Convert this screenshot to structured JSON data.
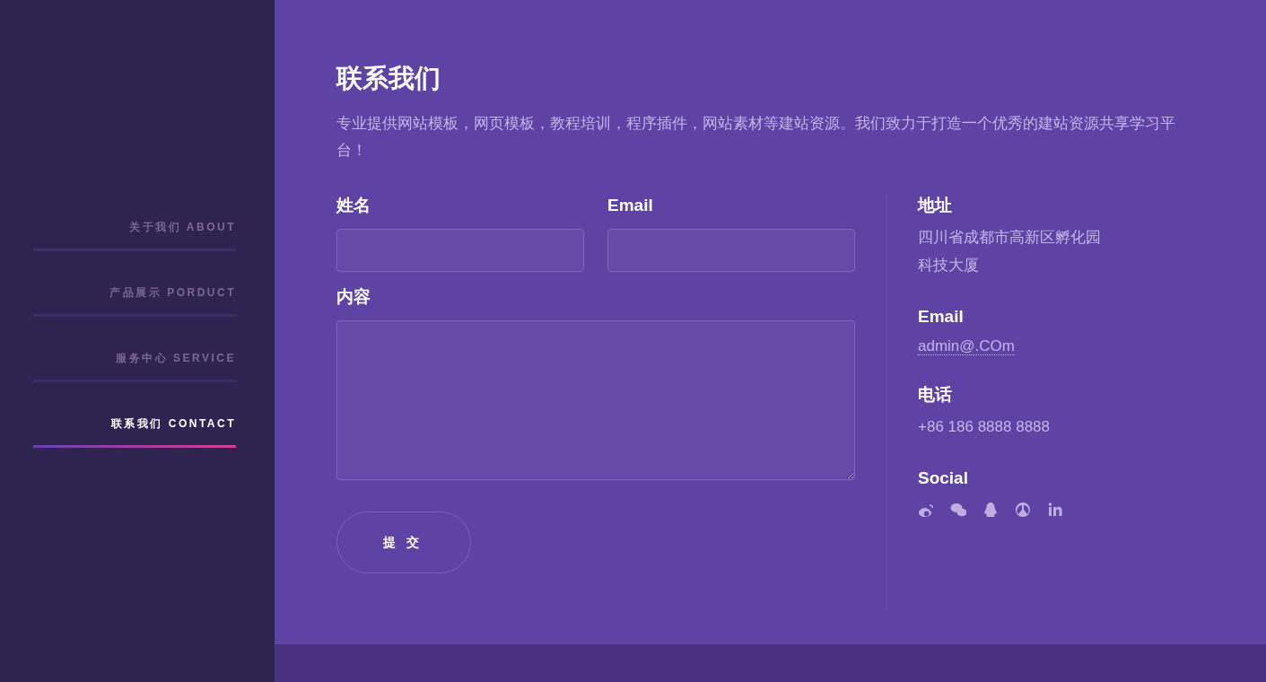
{
  "sidebar": {
    "items": [
      {
        "label": "关于我们 ABOUT",
        "selected": false
      },
      {
        "label": "产品展示 PORDUCT",
        "selected": false
      },
      {
        "label": "服务中心 SERVICE",
        "selected": false
      },
      {
        "label": "联系我们 CONTACT",
        "selected": true
      }
    ]
  },
  "contact": {
    "title": "联系我们",
    "description": "专业提供网站模板，网页模板，教程培训，程序插件，网站素材等建站资源。我们致力于打造一个优秀的建站资源共享学习平台！",
    "form": {
      "name_label": "姓名",
      "email_label": "Email",
      "content_label": "内容",
      "submit": "提交"
    },
    "info": {
      "address_label": "地址",
      "address_lines": [
        "四川省成都市高新区孵化园",
        "科技大厦"
      ],
      "email_label": "Email",
      "email": "admin@.COm",
      "phone_label": "电话",
      "phone": "+86 186 8888 8888",
      "social_label": "Social"
    }
  }
}
